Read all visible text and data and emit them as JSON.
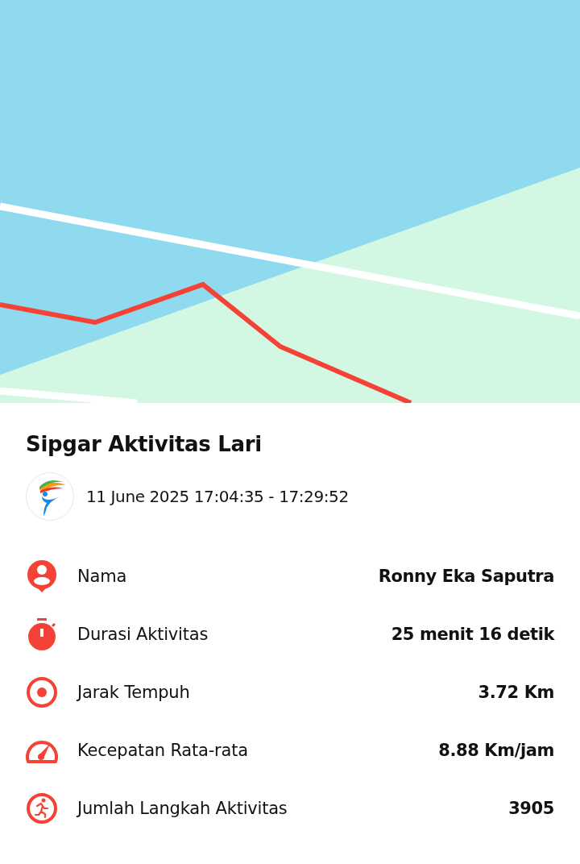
{
  "title": "Sipgar Aktivitas Lari",
  "datetime": "11 June 2025 17:04:35 - 17:29:52",
  "stats": [
    {
      "kind": "person",
      "label": "Nama",
      "value": "Ronny Eka Saputra"
    },
    {
      "kind": "timer",
      "label": "Durasi Aktivitas",
      "value": "25 menit 16 detik"
    },
    {
      "kind": "target",
      "label": "Jarak Tempuh",
      "value": "3.72 Km"
    },
    {
      "kind": "speed",
      "label": "Kecepatan Rata-rata",
      "value": "8.88 Km/jam"
    },
    {
      "kind": "run",
      "label": "Jumlah Langkah Aktivitas",
      "value": "3905"
    }
  ]
}
